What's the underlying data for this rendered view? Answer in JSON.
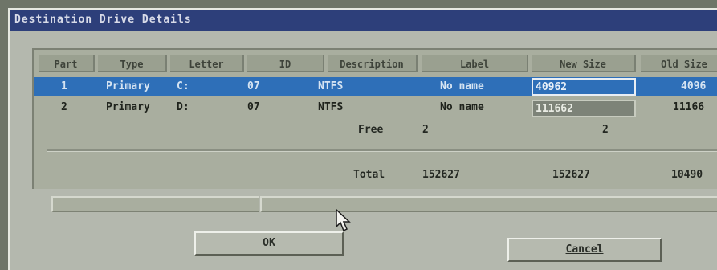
{
  "window": {
    "title": "Destination Drive Details"
  },
  "table": {
    "headers": [
      "Part",
      "Type",
      "Letter",
      "ID",
      "Description",
      "Label",
      "New Size",
      "Old Size"
    ],
    "rows": [
      {
        "part": "1",
        "type": "Primary",
        "letter": "C:",
        "id": "07",
        "description": "NTFS",
        "label": "No name",
        "new_size": "40962",
        "old_size": "4096"
      },
      {
        "part": "2",
        "type": "Primary",
        "letter": "D:",
        "id": "07",
        "description": "NTFS",
        "label": "No name",
        "new_size": "111662",
        "old_size": "11166"
      }
    ],
    "free": {
      "label": "Free",
      "value": "2",
      "new_size": "2"
    },
    "total": {
      "label": "Total",
      "value": "152627",
      "new_size": "152627",
      "old_size": "10490"
    }
  },
  "buttons": {
    "ok": "OK",
    "cancel": "Cancel"
  },
  "colors": {
    "title_bar": "#2d3f7a",
    "selection": "#2e6fb8",
    "dialog": "#b4b8ae"
  }
}
